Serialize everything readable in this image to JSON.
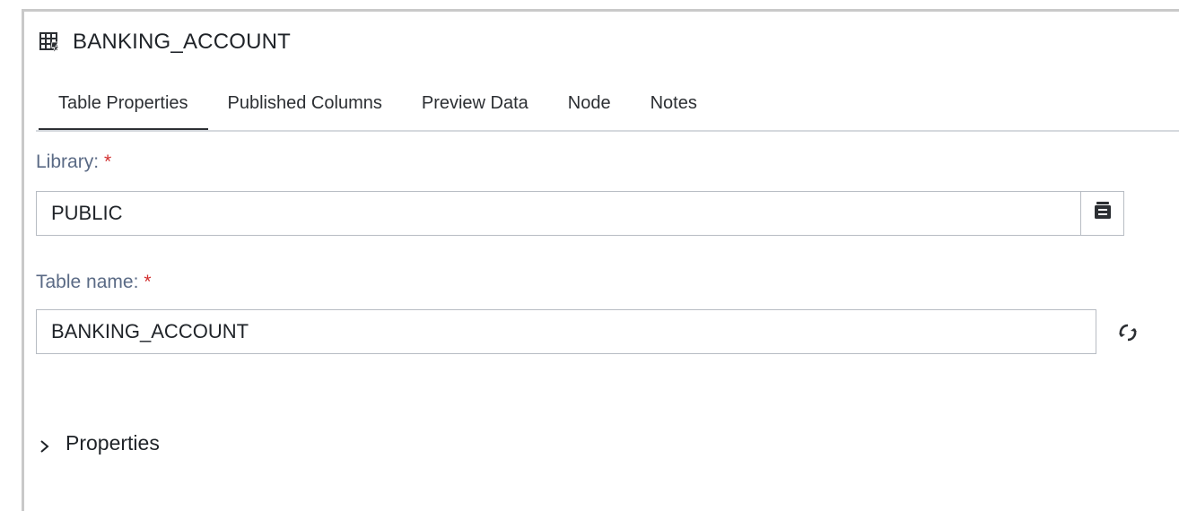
{
  "header": {
    "title": "BANKING_ACCOUNT",
    "icon": "table-icon"
  },
  "tabs": [
    {
      "label": "Table Properties",
      "active": true
    },
    {
      "label": "Published Columns",
      "active": false
    },
    {
      "label": "Preview Data",
      "active": false
    },
    {
      "label": "Node",
      "active": false
    },
    {
      "label": "Notes",
      "active": false
    }
  ],
  "form": {
    "library": {
      "label": "Library:",
      "required_marker": "*",
      "value": "PUBLIC",
      "button_icon": "library-browse-icon"
    },
    "table_name": {
      "label": "Table name:",
      "required_marker": "*",
      "value": "BANKING_ACCOUNT",
      "button_icon": "refresh-icon"
    }
  },
  "sections": {
    "properties": {
      "label": "Properties",
      "expanded": false,
      "icon": "chevron-right-icon"
    }
  },
  "colors": {
    "label": "#5a6a85",
    "required": "#d22f2f",
    "border": "#b7bcc3",
    "tab_underline": "#2c2f33"
  }
}
